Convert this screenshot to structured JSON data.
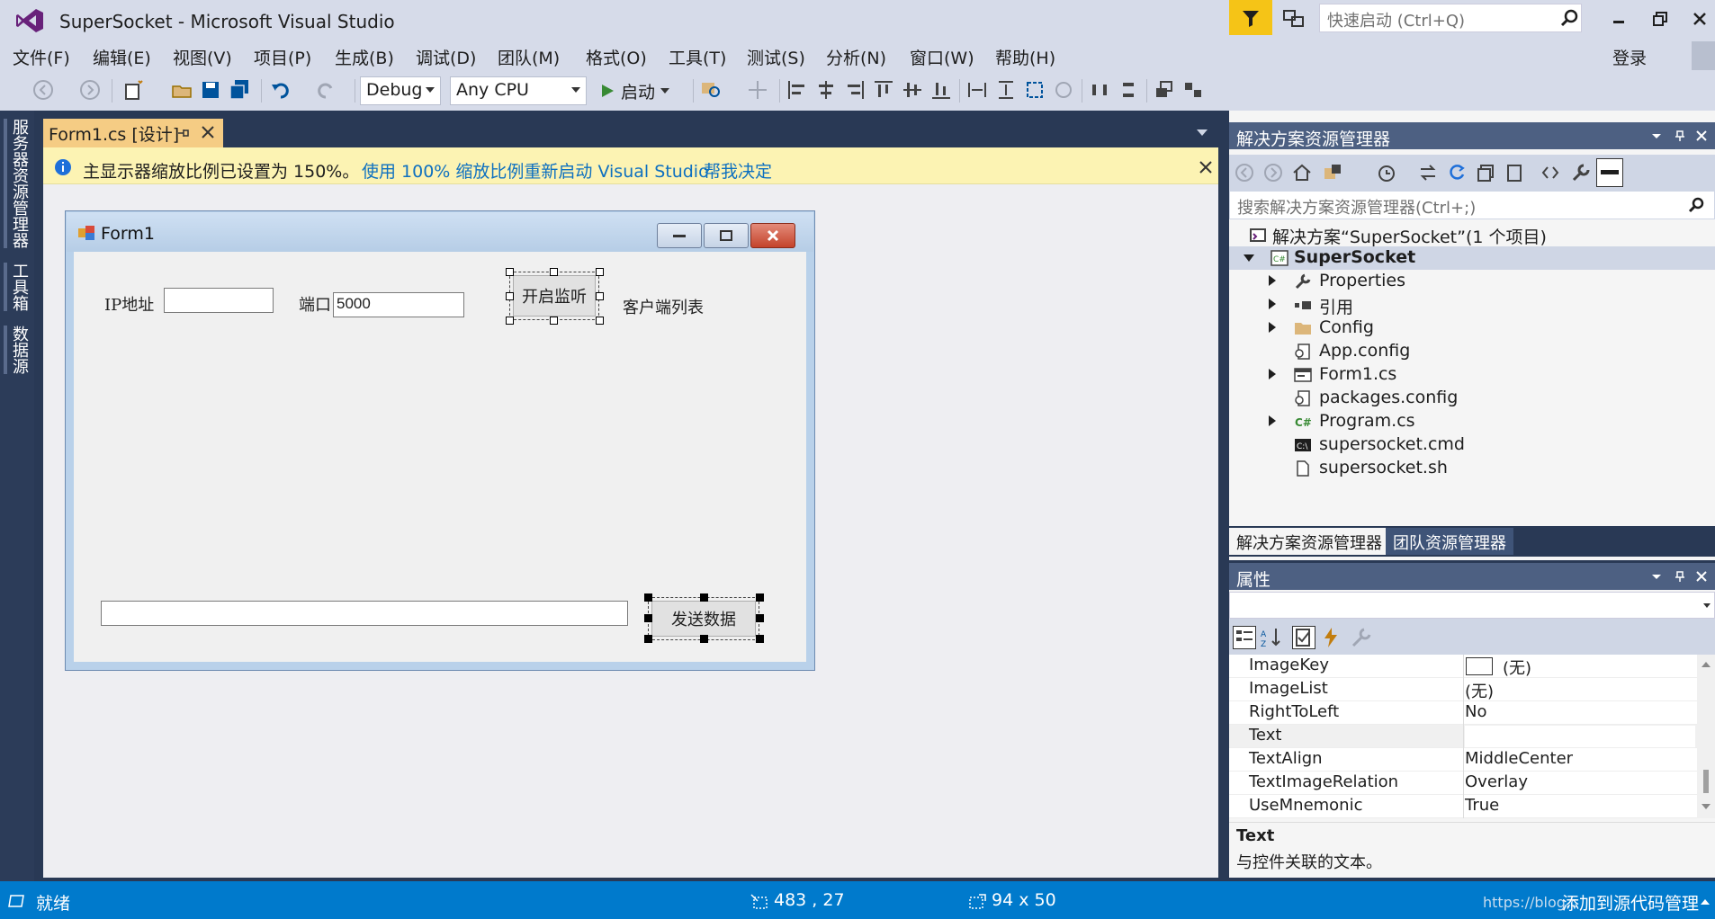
{
  "title_bar": {
    "app_title": "SuperSocket - Microsoft Visual Studio",
    "quick_launch_placeholder": "快速启动 (Ctrl+Q)"
  },
  "menu": {
    "items": [
      "文件(F)",
      "编辑(E)",
      "视图(V)",
      "项目(P)",
      "生成(B)",
      "调试(D)",
      "团队(M)",
      "格式(O)",
      "工具(T)",
      "测试(S)",
      "分析(N)",
      "窗口(W)",
      "帮助(H)"
    ],
    "sign_in": "登录"
  },
  "toolbar": {
    "config": "Debug",
    "platform": "Any CPU",
    "start_label": "启动"
  },
  "side_tabs": [
    "服务器资源管理器",
    "工具箱",
    "数据源"
  ],
  "doc_tab": {
    "label": "Form1.cs [设计]"
  },
  "infobar": {
    "message": "主显示器缩放比例已设置为 150%。",
    "link_restart": "使用 100% 缩放比例重新启动 Visual Studio",
    "link_decide": "帮我决定"
  },
  "form": {
    "title": "Form1",
    "ip_label": "IP地址",
    "ip_value": "",
    "port_label": "端口",
    "port_value": "5000",
    "listen_button": "开启监听",
    "client_list_label": "客户端列表",
    "send_input_value": "",
    "send_button": "发送数据"
  },
  "solution_explorer": {
    "title": "解决方案资源管理器",
    "search_placeholder": "搜索解决方案资源管理器(Ctrl+;)",
    "solution": "解决方案“SuperSocket”(1 个项目)",
    "project": "SuperSocket",
    "items": [
      "Properties",
      "引用",
      "Config",
      "App.config",
      "Form1.cs",
      "packages.config",
      "Program.cs",
      "supersocket.cmd",
      "supersocket.sh"
    ],
    "tabs": [
      "解决方案资源管理器",
      "团队资源管理器"
    ]
  },
  "properties": {
    "title": "属性",
    "rows": [
      {
        "name": "ImageKey",
        "value": "(无)"
      },
      {
        "name": "ImageList",
        "value": "(无)"
      },
      {
        "name": "RightToLeft",
        "value": "No"
      },
      {
        "name": "Text",
        "value": ""
      },
      {
        "name": "TextAlign",
        "value": "MiddleCenter"
      },
      {
        "name": "TextImageRelation",
        "value": "Overlay"
      },
      {
        "name": "UseMnemonic",
        "value": "True"
      }
    ],
    "desc_title": "Text",
    "desc_text": "与控件关联的文本。"
  },
  "status": {
    "ready": "就绪",
    "position": "483 , 27",
    "size": "94 x 50",
    "source_control": "添加到源代码管理",
    "watermark": "https://blog.c"
  },
  "colors": {
    "accent": "#007acc",
    "chrome": "#d6dbe9",
    "dark_bg": "#293955",
    "infobar": "#fcf3b3",
    "tab_active": "#f5cc84"
  }
}
